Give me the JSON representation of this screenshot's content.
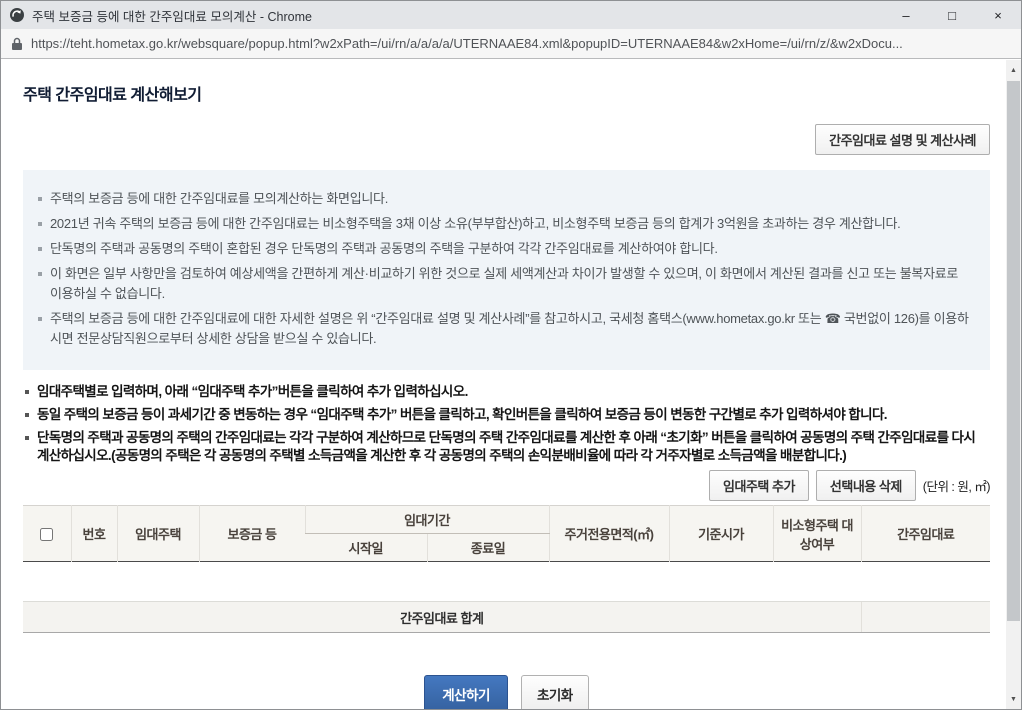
{
  "window": {
    "title": "주택 보증금 등에 대한 간주임대료 모의계산 - Chrome",
    "url": "https://teht.hometax.go.kr/websquare/popup.html?w2xPath=/ui/rn/a/a/a/a/UTERNAAE84.xml&popupID=UTERNAAE84&w2xHome=/ui/rn/z/&w2xDocu...",
    "controls": {
      "minimize": "–",
      "maximize": "□",
      "close": "×"
    }
  },
  "icons": {
    "favicon": "circled-arrow",
    "lock": "padlock",
    "scroll_up": "▲",
    "scroll_down": "▼"
  },
  "colors": {
    "accent_blue": "#35619f",
    "info_box_bg": "#f0f4f8",
    "table_header_bg": "#f6f5f1",
    "titlebar_bg": "#e3e5e8"
  },
  "page": {
    "title": "주택 간주임대료 계산해보기",
    "help_button": "간주임대료 설명 및 계산사례",
    "info_notes": [
      "주택의 보증금 등에 대한 간주임대료를 모의계산하는 화면입니다.",
      "2021년 귀속 주택의 보증금 등에 대한 간주임대료는 비소형주택을 3채 이상 소유(부부합산)하고, 비소형주택 보증금 등의 합계가 3억원을 초과하는 경우 계산합니다.",
      "단독명의 주택과 공동명의 주택이 혼합된 경우 단독명의 주택과 공동명의 주택을 구분하여 각각 간주임대료를 계산하여야 합니다.",
      "이 화면은 일부 사항만을 검토하여 예상세액을 간편하게 계산·비교하기 위한 것으로 실제 세액계산과 차이가 발생할 수 있으며, 이 화면에서 계산된 결과를 신고 또는 불복자료로 이용하실 수 없습니다.",
      "주택의 보증금 등에 대한 간주임대료에 대한 자세한 설명은 위 “간주임대료 설명 및 계산사례”를 참고하시고, 국세청 홈택스(www.hometax.go.kr 또는 ☎ 국번없이 126)를 이용하시면 전문상담직원으로부터 상세한 상담을 받으실 수 있습니다."
    ],
    "instruction_notes": [
      "임대주택별로 입력하며, 아래 “임대주택 추가”버튼을 클릭하여 추가 입력하십시오.",
      "동일 주택의 보증금 등이 과세기간 중 변동하는 경우 “임대주택 추가” 버튼을 클릭하고, 확인버튼을 클릭하여 보증금 등이 변동한 구간별로 추가 입력하셔야 합니다.",
      "단독명의 주택과 공동명의 주택의 간주임대료는 각각 구분하여 계산하므로 단독명의 주택 간주임대료를 계산한 후 아래 “초기화” 버튼을 클릭하여 공동명의 주택 간주임대료를 다시 계산하십시오.(공동명의 주택은 각 공동명의 주택별 소득금액을 계산한 후 각 공동명의 주택의 손익분배비율에 따라 각 거주자별로 소득금액을 배분합니다.)"
    ],
    "add_button": "임대주택 추가",
    "delete_button": "선택내용 삭제",
    "unit_label": "(단위 : 원, ㎡)",
    "table": {
      "header": {
        "no": "번호",
        "rental_house": "임대주택",
        "deposit": "보증금 등",
        "rental_period": "임대기간",
        "start_date": "시작일",
        "end_date": "종료일",
        "area": "주거전용면적(㎡)",
        "standard_price": "기준시가",
        "non_small_house": "비소형주택 대상여부",
        "deemed_rent": "간주임대료"
      },
      "rows": [],
      "footer_label": "간주임대료 합계",
      "footer_value": ""
    },
    "calculate_button": "계산하기",
    "reset_button": "초기화"
  }
}
